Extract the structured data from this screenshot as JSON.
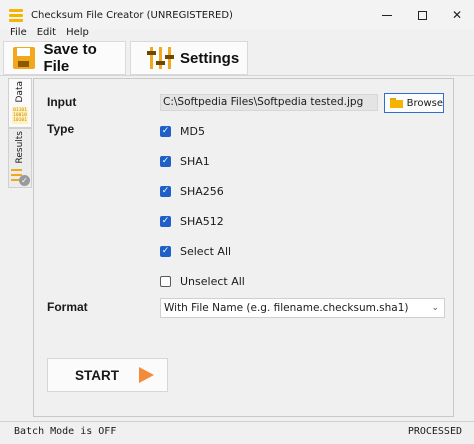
{
  "window": {
    "title": "Checksum File Creator (UNREGISTERED)",
    "controls": {
      "minimize_icon": "minimize-icon",
      "maximize_icon": "maximize-icon",
      "close_glyph": "✕"
    }
  },
  "menu": {
    "items": [
      "File",
      "Edit",
      "Help"
    ]
  },
  "toolbar": {
    "save_label": "Save to File",
    "settings_label": "Settings",
    "save_icon": "floppy-disk-icon",
    "settings_icon": "sliders-icon"
  },
  "side_tabs": {
    "data_label": "Data",
    "results_label": "Results",
    "binary_lines": [
      "01101",
      "10010",
      "10101"
    ]
  },
  "input": {
    "label": "Input",
    "path_value": "C:\\Softpedia Files\\Softpedia tested.jpg",
    "browse_label": "Browse"
  },
  "type": {
    "label": "Type",
    "options": [
      {
        "label": "MD5",
        "checked": true
      },
      {
        "label": "SHA1",
        "checked": true
      },
      {
        "label": "SHA256",
        "checked": true
      },
      {
        "label": "SHA512",
        "checked": true
      },
      {
        "label": "Select All",
        "checked": true
      },
      {
        "label": "Unselect All",
        "checked": false
      }
    ],
    "check_glyph": "✓"
  },
  "format": {
    "label": "Format",
    "selected": "With File Name (e.g. filename.checksum.sha1)",
    "arrow_glyph": "⌄"
  },
  "start": {
    "label": "START"
  },
  "status": {
    "left": "Batch Mode is OFF",
    "right": "PROCESSED"
  },
  "colors": {
    "accent": "#f2a81d",
    "checkbox": "#1f5fc8",
    "browse_border": "#2f6fd1",
    "play": "#f08c3a"
  }
}
